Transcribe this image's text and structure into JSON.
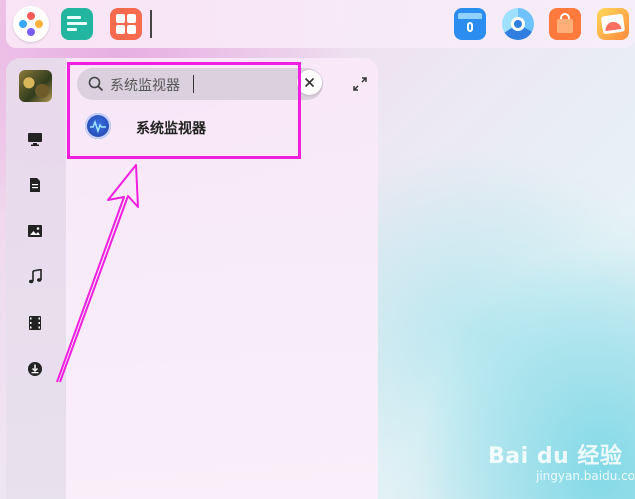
{
  "taskbar": {
    "pinned": [
      {
        "name": "launcher-icon"
      },
      {
        "name": "terminal-icon"
      },
      {
        "name": "app-store-grid-icon"
      },
      {
        "name": "file-manager-icon"
      },
      {
        "name": "browser-icon"
      },
      {
        "name": "shopping-store-icon"
      },
      {
        "name": "photo-viewer-icon"
      }
    ]
  },
  "launcher": {
    "sidebar": {
      "items": [
        {
          "icon": "computer-icon"
        },
        {
          "icon": "document-icon"
        },
        {
          "icon": "picture-icon"
        },
        {
          "icon": "music-icon"
        },
        {
          "icon": "video-icon"
        },
        {
          "icon": "download-icon"
        }
      ]
    },
    "search": {
      "value": "系统监视器"
    },
    "results": [
      {
        "label": "系统监视器",
        "icon": "system-monitor-icon"
      }
    ]
  },
  "watermark": {
    "brand": "Bai du 经验",
    "url": "jingyan.baidu.com"
  },
  "colors": {
    "annotation": "#f01fe0",
    "accent": "#2b8df0"
  }
}
